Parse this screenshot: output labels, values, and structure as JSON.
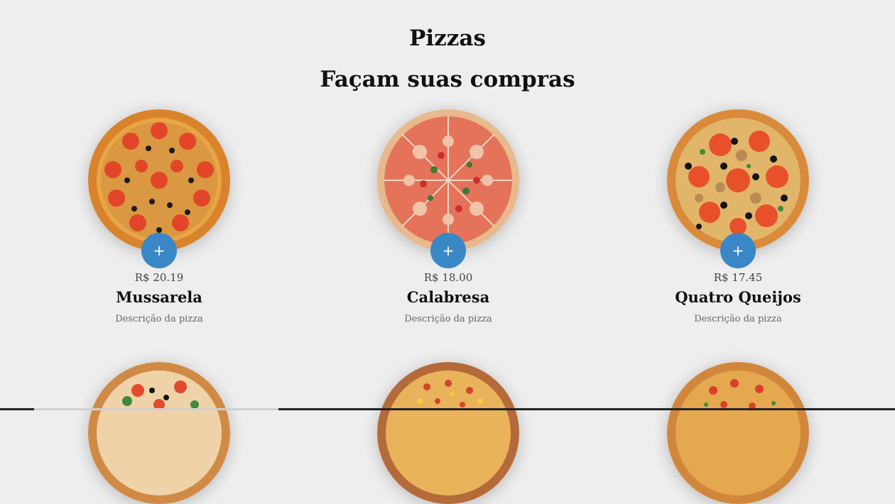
{
  "header": {
    "title": "Pizzas",
    "subtitle": "Façam suas compras"
  },
  "products": [
    {
      "price": "R$ 20.19",
      "name": "Mussarela",
      "description": "Descrição da pizza",
      "add_label": "+",
      "image": "pizza-tomato-olive"
    },
    {
      "price": "R$ 18.00",
      "name": "Calabresa",
      "description": "Descrição da pizza",
      "add_label": "+",
      "image": "pizza-calabresa"
    },
    {
      "price": "R$ 17.45",
      "name": "Quatro Queijos",
      "description": "Descrição da pizza",
      "add_label": "+",
      "image": "pizza-quatro-queijos"
    }
  ],
  "colors": {
    "background": "#eeeeee",
    "accent": "#3a87c6"
  }
}
